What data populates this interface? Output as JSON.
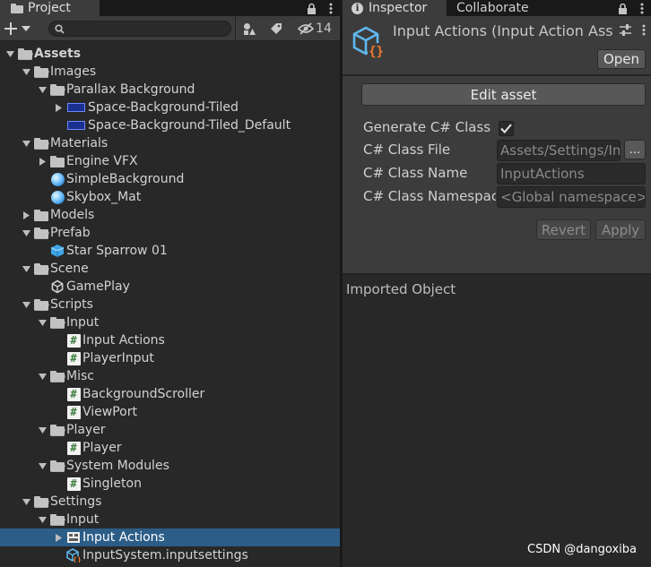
{
  "project_panel": {
    "tab_label": "Project",
    "hidden_count": "14"
  },
  "tree": [
    {
      "label": "Assets",
      "depth": 0,
      "expanded": true,
      "icon": "folder-open-icon",
      "bold": true
    },
    {
      "label": "Images",
      "depth": 1,
      "expanded": true,
      "icon": "folder-open-icon"
    },
    {
      "label": "Parallax Background",
      "depth": 2,
      "expanded": true,
      "icon": "folder-open-icon"
    },
    {
      "label": "Space-Background-Tiled",
      "depth": 3,
      "expanded": false,
      "icon": "sprite-icon",
      "has_arrow": true
    },
    {
      "label": "Space-Background-Tiled_Default",
      "depth": 3,
      "icon": "sprite-icon"
    },
    {
      "label": "Materials",
      "depth": 1,
      "expanded": true,
      "icon": "folder-open-icon"
    },
    {
      "label": "Engine VFX",
      "depth": 2,
      "expanded": false,
      "icon": "folder-icon"
    },
    {
      "label": "SimpleBackground",
      "depth": 2,
      "icon": "material-icon"
    },
    {
      "label": "Skybox_Mat",
      "depth": 2,
      "icon": "material-icon"
    },
    {
      "label": "Models",
      "depth": 1,
      "expanded": false,
      "icon": "folder-icon"
    },
    {
      "label": "Prefab",
      "depth": 1,
      "expanded": true,
      "icon": "folder-open-icon"
    },
    {
      "label": "Star Sparrow 01",
      "depth": 2,
      "icon": "prefab-icon"
    },
    {
      "label": "Scene",
      "depth": 1,
      "expanded": true,
      "icon": "folder-open-icon"
    },
    {
      "label": "GamePlay",
      "depth": 2,
      "icon": "scene-icon"
    },
    {
      "label": "Scripts",
      "depth": 1,
      "expanded": true,
      "icon": "folder-open-icon"
    },
    {
      "label": "Input",
      "depth": 2,
      "expanded": true,
      "icon": "folder-open-icon"
    },
    {
      "label": "Input Actions",
      "depth": 3,
      "icon": "script-icon"
    },
    {
      "label": "PlayerInput",
      "depth": 3,
      "icon": "script-icon"
    },
    {
      "label": "Misc",
      "depth": 2,
      "expanded": true,
      "icon": "folder-open-icon"
    },
    {
      "label": "BackgroundScroller",
      "depth": 3,
      "icon": "script-icon"
    },
    {
      "label": "ViewPort",
      "depth": 3,
      "icon": "script-icon"
    },
    {
      "label": "Player",
      "depth": 2,
      "expanded": true,
      "icon": "folder-open-icon"
    },
    {
      "label": "Player",
      "depth": 3,
      "icon": "script-icon"
    },
    {
      "label": "System Modules",
      "depth": 2,
      "expanded": true,
      "icon": "folder-open-icon"
    },
    {
      "label": "Singleton",
      "depth": 3,
      "icon": "script-icon"
    },
    {
      "label": "Settings",
      "depth": 1,
      "expanded": true,
      "icon": "folder-open-icon"
    },
    {
      "label": "Input",
      "depth": 2,
      "expanded": true,
      "icon": "folder-open-icon"
    },
    {
      "label": "Input Actions",
      "depth": 3,
      "expanded": false,
      "icon": "input-actions-asset-icon",
      "selected": true,
      "has_arrow": true
    },
    {
      "label": "InputSystem.inputsettings",
      "depth": 3,
      "icon": "input-settings-icon"
    }
  ],
  "inspector": {
    "tab_label": "Inspector",
    "tab2_label": "Collaborate",
    "asset_title": "Input Actions (Input Action Asset)",
    "open_label": "Open",
    "edit_asset_label": "Edit asset",
    "generate_label": "Generate C# Class",
    "generate_checked": true,
    "class_file_label": "C# Class File",
    "class_file_value": "Assets/Settings/Input/Input Actions.cs",
    "dots_label": "...",
    "class_name_label": "C# Class Name",
    "class_name_placeholder": "InputActions",
    "namespace_label": "C# Class Namespace",
    "namespace_placeholder": "<Global namespace>",
    "revert_label": "Revert",
    "apply_label": "Apply",
    "imported_label": "Imported Object"
  },
  "watermark": "CSDN @dangoxiba",
  "colors": {
    "selection": "#2c5d87",
    "panel": "#3c3c3c",
    "background": "#282828",
    "script_icon": "#3f7f3f",
    "asset_icon_cube": "#5fb7ee",
    "asset_icon_braces": "#ef7b2f"
  }
}
